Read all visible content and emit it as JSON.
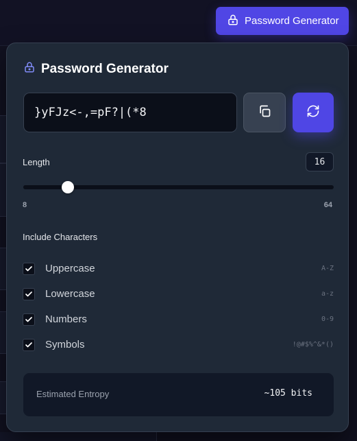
{
  "colors": {
    "accent": "#4f46e5",
    "panel": "#1f2937",
    "field": "#0b0f19"
  },
  "trigger": {
    "icon": "lock-icon",
    "label": "Password Generator"
  },
  "panel": {
    "icon": "lock-icon",
    "title": "Password Generator"
  },
  "password": {
    "value": "}yFJz<-,=pF?|(*8"
  },
  "actions": {
    "copy_icon": "copy-icon",
    "refresh_icon": "refresh-icon"
  },
  "length": {
    "label": "Length",
    "value": "16",
    "min": 8,
    "max": 64,
    "min_label": "8",
    "max_label": "64"
  },
  "include": {
    "label": "Include Characters",
    "options": [
      {
        "label": "Uppercase",
        "hint": "A-Z",
        "checked": true
      },
      {
        "label": "Lowercase",
        "hint": "a-z",
        "checked": true
      },
      {
        "label": "Numbers",
        "hint": "0-9",
        "checked": true
      },
      {
        "label": "Symbols",
        "hint": "!@#$%^&*()",
        "checked": true
      }
    ]
  },
  "entropy": {
    "label": "Estimated Entropy",
    "value": "~105 bits"
  }
}
